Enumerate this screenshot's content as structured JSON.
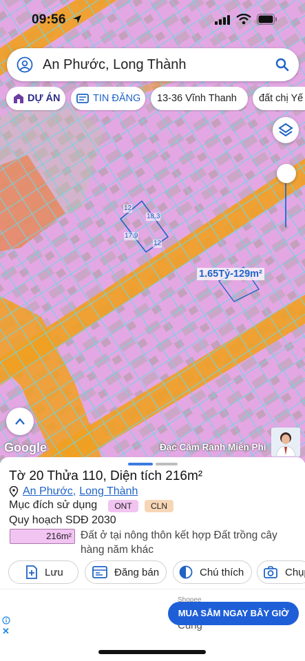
{
  "status_bar": {
    "time": "09:56"
  },
  "search": {
    "value": "An Phước, Long Thành"
  },
  "chips": {
    "du_an": "DỰ ÁN",
    "tin_dang": "TIN ĐĂNG",
    "vinh_thanh": "13-36 Vĩnh Thanh",
    "dat_chi": "đất chị Yế"
  },
  "map": {
    "edges": {
      "top": "12",
      "right": "18.3",
      "left": "17.9",
      "bottom": "12"
    },
    "price_tag": "1.65Tỷ-129m²",
    "google": "Google",
    "promo": "Đạc Cắm Ranh Miễn Phí"
  },
  "parcel": {
    "title": "Tờ 20 Thửa 110, Diện tích 216m²",
    "commune": "An Phước",
    "district": "Long Thành",
    "separator": ",",
    "purpose_label": "Mục đích sử dụng",
    "purpose_codes": [
      "ONT",
      "CLN"
    ],
    "plan_label": "Quy hoạch SDĐ 2030",
    "plan_area": "216m²",
    "plan_description": "Đất ở tại nông thôn kết hợp Đất trồng cây hàng năm khác"
  },
  "actions": {
    "save": "Lưu",
    "post_sale": "Đăng bán",
    "legend": "Chú thích",
    "capture": "Chụp"
  },
  "ad": {
    "brand": "Shopee",
    "cta": "MUA SẮM NGAY BÂY GIỜ",
    "subtext": "Cùng"
  },
  "colors": {
    "zone_residential": "#e3a8e3",
    "road_planned": "#f0a020",
    "accent_blue": "#1f63c7",
    "cta_blue": "#1e5fd8"
  }
}
